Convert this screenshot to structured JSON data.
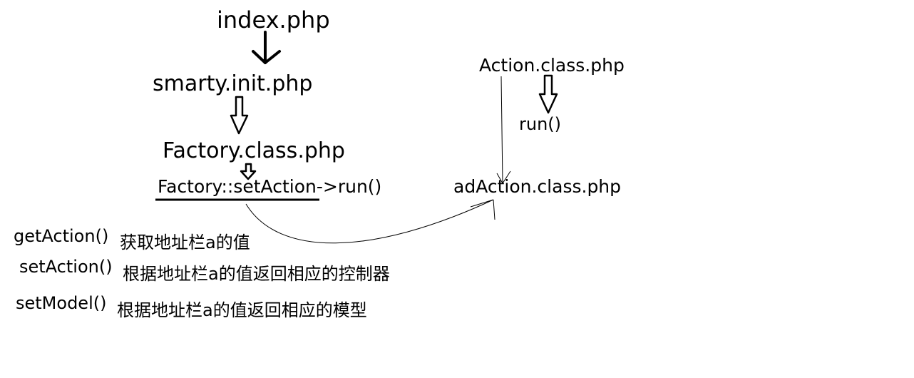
{
  "nodes": {
    "index": "index.php",
    "smarty_init": "smarty.init.php",
    "factory": "Factory.class.php",
    "factory_call_underlined": "Factory::setAction",
    "factory_call_rest": "->run()",
    "action": "Action.class.php",
    "run": "run()",
    "ad_action": "adAction.class.php"
  },
  "methods": [
    {
      "name": "getAction()",
      "description": "获取地址栏a的值"
    },
    {
      "name": "setAction()",
      "description": "根据地址栏a的值返回相应的控制器"
    },
    {
      "name": "setModel()",
      "description": "根据地址栏a的值返回相应的模型"
    }
  ]
}
